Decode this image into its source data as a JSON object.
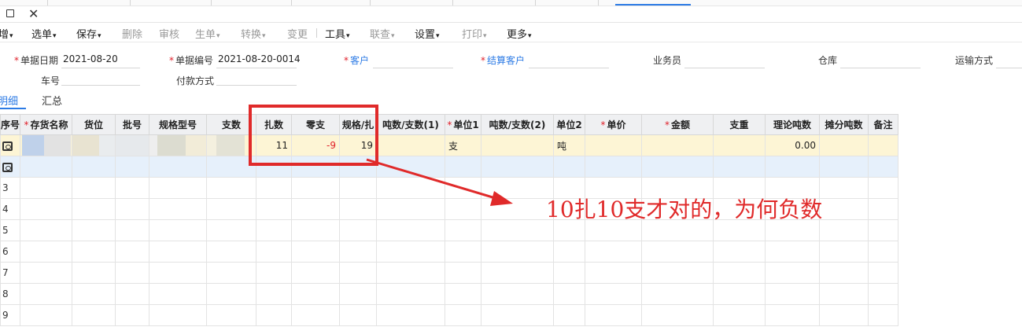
{
  "toolbar": {
    "items": [
      {
        "label": "增",
        "caret": true,
        "enabled": true
      },
      {
        "label": "选单",
        "caret": true,
        "enabled": true
      },
      {
        "label": "保存",
        "caret": true,
        "enabled": true
      },
      {
        "label": "删除",
        "caret": false,
        "enabled": false
      },
      {
        "label": "审核",
        "caret": false,
        "enabled": false
      },
      {
        "label": "生单",
        "caret": true,
        "enabled": false
      },
      {
        "label": "转换",
        "caret": true,
        "enabled": false
      },
      {
        "label": "变更",
        "caret": false,
        "enabled": false
      },
      {
        "label": "工具",
        "caret": true,
        "enabled": true
      },
      {
        "label": "联查",
        "caret": true,
        "enabled": false
      },
      {
        "label": "设置",
        "caret": true,
        "enabled": true
      },
      {
        "label": "打印",
        "caret": true,
        "enabled": false
      },
      {
        "label": "更多",
        "caret": true,
        "enabled": true
      }
    ]
  },
  "form": {
    "date_label": "单据日期",
    "date_value": "2021-08-20",
    "number_label": "单据编号",
    "number_value": "2021-08-20-0014",
    "customer_label": "客户",
    "settle_customer_label": "结算客户",
    "salesman_label": "业务员",
    "warehouse_label": "仓库",
    "transport_label": "运输方式",
    "vehicle_label": "车号",
    "payment_label": "付款方式"
  },
  "subtabs": {
    "detail": "明细",
    "summary": "汇总"
  },
  "grid": {
    "columns": [
      {
        "label": "序号",
        "required": false
      },
      {
        "label": "存货名称",
        "required": true
      },
      {
        "label": "货位",
        "required": false
      },
      {
        "label": "批号",
        "required": false
      },
      {
        "label": "规格型号",
        "required": false
      },
      {
        "label": "支数",
        "required": false
      },
      {
        "label": "扎数",
        "required": false
      },
      {
        "label": "零支",
        "required": false
      },
      {
        "label": "规格/扎",
        "required": false
      },
      {
        "label": "吨数/支数(1)",
        "required": false
      },
      {
        "label": "单位1",
        "required": true
      },
      {
        "label": "吨数/支数(2)",
        "required": false
      },
      {
        "label": "单位2",
        "required": false
      },
      {
        "label": "单价",
        "required": true
      },
      {
        "label": "金额",
        "required": true
      },
      {
        "label": "支重",
        "required": false
      },
      {
        "label": "理论吨数",
        "required": false
      },
      {
        "label": "摊分吨数",
        "required": false
      },
      {
        "label": "备注",
        "required": false
      }
    ],
    "row1": {
      "bundles": "11",
      "loose": "-9",
      "per_bundle": "19",
      "unit1": "支",
      "unit2": "吨",
      "theoretical_tons": "0.00"
    },
    "row_numbers": [
      "3",
      "4",
      "5",
      "6",
      "7",
      "8",
      "9"
    ]
  },
  "annotation": {
    "text": "10扎10支才对的，为何负数",
    "color": "#e02a2a"
  }
}
